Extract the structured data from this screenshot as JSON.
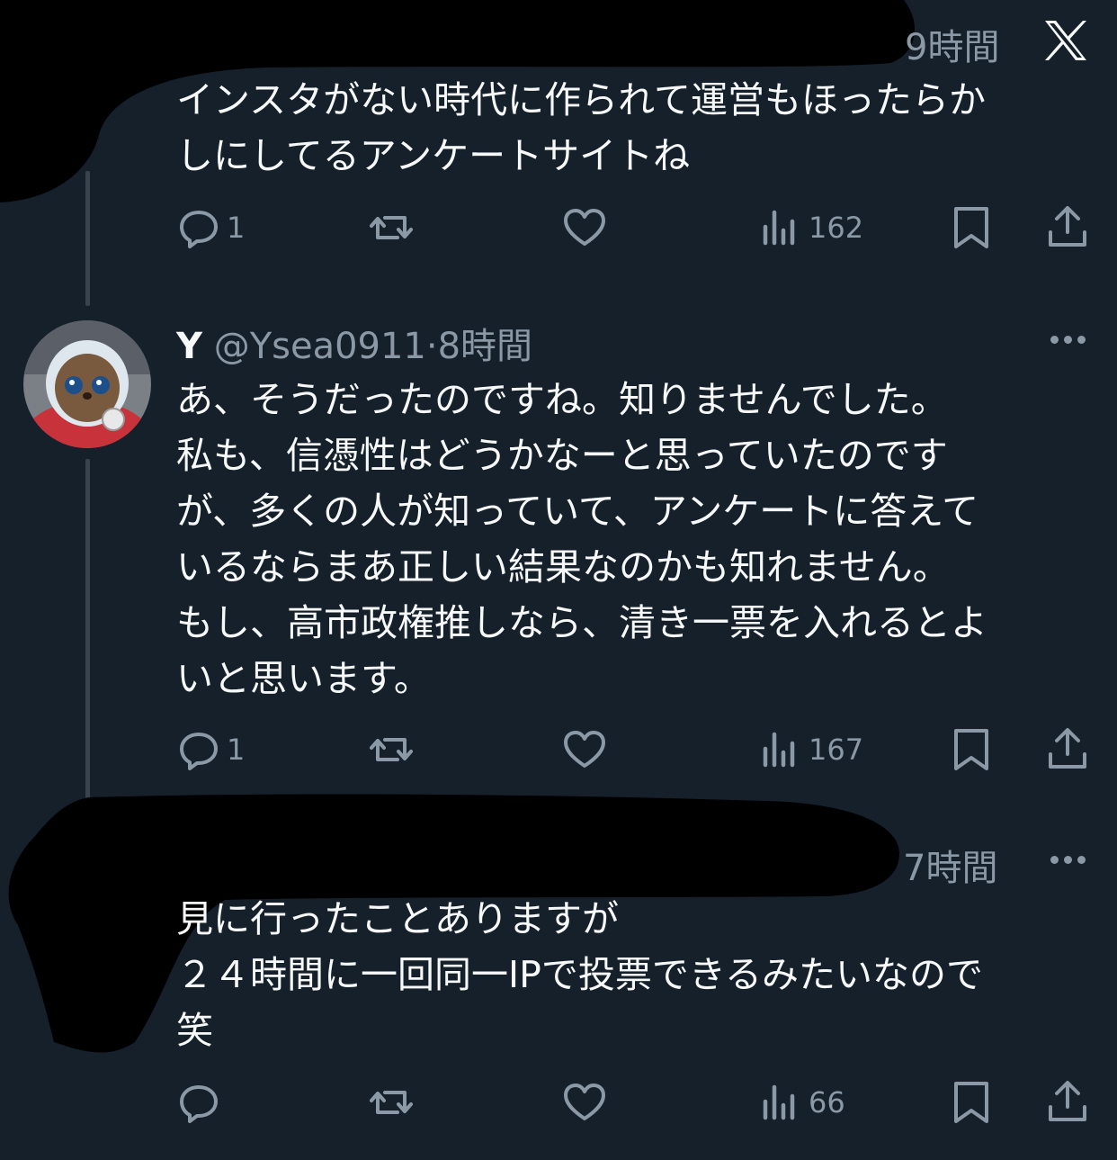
{
  "tweets": [
    {
      "time": "9時間",
      "text": "インスタがない時代に作られて運営もほったらか\nしにしてるアンケートサイトね",
      "actions": {
        "reply_count": "1",
        "retweet_count": "",
        "like_count": "",
        "view_count": "162"
      }
    },
    {
      "display_name": "Y",
      "handle": "@Ysea0911",
      "separator": "·",
      "time": "8時間",
      "text": "あ、そうだったのですね。知りませんでした。\n私も、信憑性はどうかなーと思っていたのです\nが、多くの人が知っていて、アンケートに答えて\nいるならまあ正しい結果なのかも知れません。\nもし、高市政権推しなら、清き一票を入れるとよ\nいと思います。",
      "actions": {
        "reply_count": "1",
        "retweet_count": "",
        "like_count": "",
        "view_count": "167"
      }
    },
    {
      "time": "7時間",
      "text": "見に行ったことありますが\n２４時間に一回同一IPで投票できるみたいなので\n笑",
      "actions": {
        "reply_count": "",
        "retweet_count": "",
        "like_count": "",
        "view_count": "66"
      }
    }
  ],
  "colors": {
    "background": "#15202b",
    "text": "#f7f9f9",
    "secondary": "#8b98a5",
    "thread_line": "#38444d"
  },
  "icons": [
    "x-logo-icon",
    "reply-icon",
    "retweet-icon",
    "like-icon",
    "views-icon",
    "bookmark-icon",
    "share-icon",
    "more-icon"
  ]
}
